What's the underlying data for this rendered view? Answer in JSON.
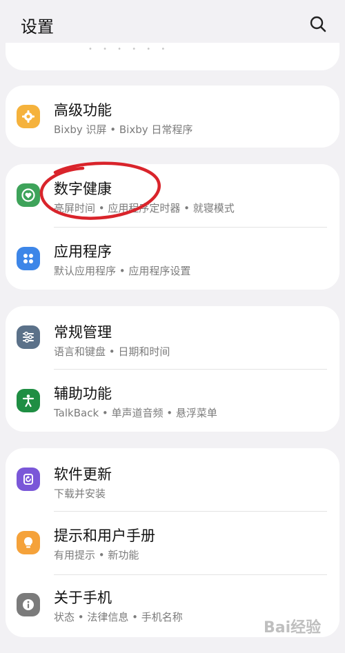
{
  "header": {
    "title": "设置",
    "search_icon": "search-icon"
  },
  "cards": [
    {
      "items": [
        {
          "icon": "gear-icon",
          "icon_color": "#f5b23c",
          "title": "高级功能",
          "subtitle": "Bixby 识屏 • Bixby 日常程序"
        }
      ]
    },
    {
      "items": [
        {
          "icon": "digital-wellbeing-icon",
          "icon_color": "#3ea35a",
          "title": "数字健康",
          "subtitle": "亮屏时间 • 应用程序定时器 • 就寝模式"
        },
        {
          "icon": "apps-icon",
          "icon_color": "#3d86e8",
          "title": "应用程序",
          "subtitle": "默认应用程序 • 应用程序设置"
        }
      ]
    },
    {
      "items": [
        {
          "icon": "sliders-icon",
          "icon_color": "#5b7189",
          "title": "常规管理",
          "subtitle": "语言和键盘 • 日期和时间"
        },
        {
          "icon": "accessibility-icon",
          "icon_color": "#1f8e43",
          "title": "辅助功能",
          "subtitle": "TalkBack • 单声道音频 • 悬浮菜单"
        }
      ]
    },
    {
      "items": [
        {
          "icon": "software-update-icon",
          "icon_color": "#7a57d8",
          "title": "软件更新",
          "subtitle": "下载并安装"
        },
        {
          "icon": "lightbulb-icon",
          "icon_color": "#f5a23a",
          "title": "提示和用户手册",
          "subtitle": "有用提示 • 新功能"
        },
        {
          "icon": "info-icon",
          "icon_color": "#7b7b7b",
          "title": "关于手机",
          "subtitle": "状态 • 法律信息 • 手机名称"
        }
      ]
    }
  ],
  "annotation": {
    "color": "#d9242b"
  },
  "watermark": {
    "text": "Bai经验"
  }
}
